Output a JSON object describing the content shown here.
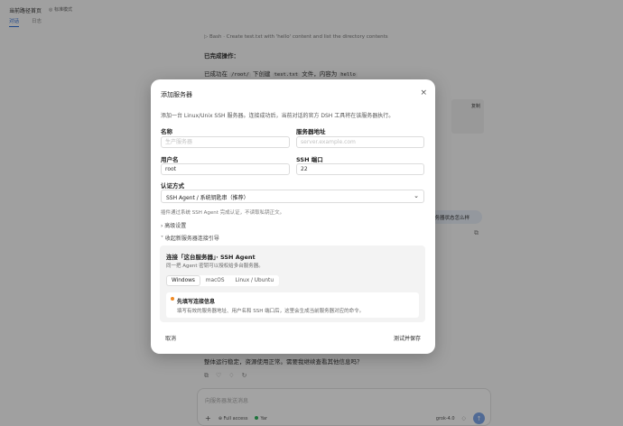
{
  "app": {
    "title": "当前路径首页",
    "mode_label": "◎ 标准模式",
    "tabs": [
      "对话",
      "日志"
    ],
    "tool_line": "▷ Bash · Create test.txt with 'hello' content and list the directory contents",
    "done_title": "已完成操作：",
    "done_prefix": "已成功在",
    "done_path": "/root/",
    "done_mid": "下创建",
    "done_file": "test.txt",
    "done_suffix": "文件，内容为",
    "done_content": "hello",
    "side_card_label": "复制",
    "side_pill_text": "服务器状态怎么样",
    "bottom_text": "整体运行稳定，资源使用正常。需要我继续查看其他信息吗？",
    "composer_placeholder": "向服务器发送消息",
    "composer_access": "Full access",
    "composer_server": "Yar",
    "composer_model": "grok-4.0"
  },
  "modal": {
    "title": "添加服务器",
    "close_label": "×",
    "description": "添加一台 Linux/Unix SSH 服务器。连接成功后，当前对话的官方 DSH 工具将在该服务器执行。",
    "name_label": "名称",
    "name_placeholder": "生产服务器",
    "address_label": "服务器地址",
    "address_placeholder": "server.example.com",
    "username_label": "用户名",
    "username_value": "root",
    "port_label": "SSH 端口",
    "port_value": "22",
    "auth_label": "认证方式",
    "auth_value": "SSH Agent / 系统钥匙串（推荐）",
    "auth_note": "插件通过系统 SSH Agent 完成认证，不读取私钥正文。",
    "advanced_label": "› 高级设置",
    "guide_toggle_label": "˅ 收起新服务器连接引导",
    "guide": {
      "title": "连接「这台服务器」· SSH Agent",
      "subtitle": "同一把 Agent 密钥可以授权给多台服务器。",
      "tabs": [
        "Windows",
        "macOS",
        "Linux / Ubuntu"
      ],
      "active_tab": "Windows",
      "step_title": "先填写连接信息",
      "step_text": "填写有效的服务器地址、用户名和 SSH 端口后，这里会生成当前服务器对应的命令。"
    },
    "cancel_label": "取消",
    "save_label": "测试并保存"
  },
  "colors": {
    "accent": "#2f6fd6",
    "step_bullet": "#f08a24",
    "overlay": "rgba(0,0,0,0.36)"
  }
}
